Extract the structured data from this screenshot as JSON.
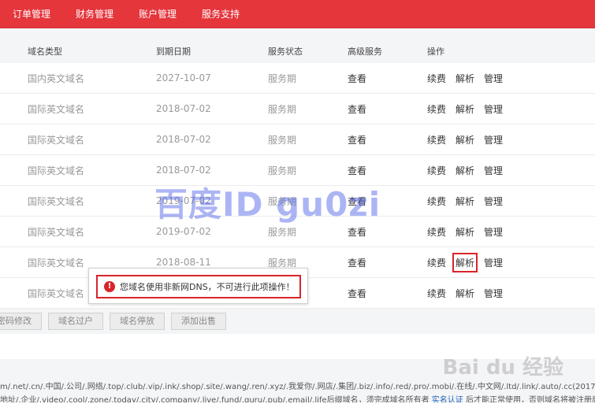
{
  "topnav": [
    "订单管理",
    "财务管理",
    "账户管理",
    "服务支持"
  ],
  "table": {
    "headers": {
      "type": "域名类型",
      "date": "到期日期",
      "status": "服务状态",
      "adv": "高级服务",
      "ops": "操作"
    },
    "rows": [
      {
        "type": "国内英文域名",
        "date": "2027-10-07",
        "status": "服务期",
        "adv": "查看"
      },
      {
        "type": "国际英文域名",
        "date": "2018-07-02",
        "status": "服务期",
        "adv": "查看"
      },
      {
        "type": "国际英文域名",
        "date": "2018-07-02",
        "status": "服务期",
        "adv": "查看"
      },
      {
        "type": "国际英文域名",
        "date": "2018-07-02",
        "status": "服务期",
        "adv": "查看"
      },
      {
        "type": "国际英文域名",
        "date": "2019-07-02",
        "status": "服务期",
        "adv": "查看"
      },
      {
        "type": "国际英文域名",
        "date": "2019-07-02",
        "status": "服务期",
        "adv": "查看"
      },
      {
        "type": "国际英文域名",
        "date": "2018-08-11",
        "status": "服务期",
        "adv": "查看"
      },
      {
        "type": "国际英文域名",
        "date": "",
        "status": "",
        "adv": "查看"
      }
    ],
    "ops": {
      "renew": "续费",
      "resolve": "解析",
      "manage": "管理"
    }
  },
  "toolbar": [
    "密码修改",
    "域名过户",
    "域名停放",
    "添加出售"
  ],
  "tip": {
    "icon": "!",
    "message": "您域名使用非新网DNS，不可进行此项操作！"
  },
  "footer": {
    "line1": "m/.net/.cn/.中国/.公司/.网络/.top/.club/.vip/.ink/.shop/.site/.wang/.ren/.xyz/.我爱你/.网店/.集团/.biz/.info/.red/.pro/.mobi/.在线/.中文网/.ltd/.link/.auto/.cc(2017.7.28起新注",
    "line2a": "地址/.企业/.video/.cool/.zone/.today/.city/.company/.live/.fund/.guru/.pub/.email/.life后缀域名，须完成域名所有者 ",
    "line2b": "实名认证",
    "line2c": " 后才能正常使用，否则域名将被注册局禁止解析"
  },
  "watermark": "百度ID gu0zi",
  "baidu_logo": "Bai du 经验"
}
